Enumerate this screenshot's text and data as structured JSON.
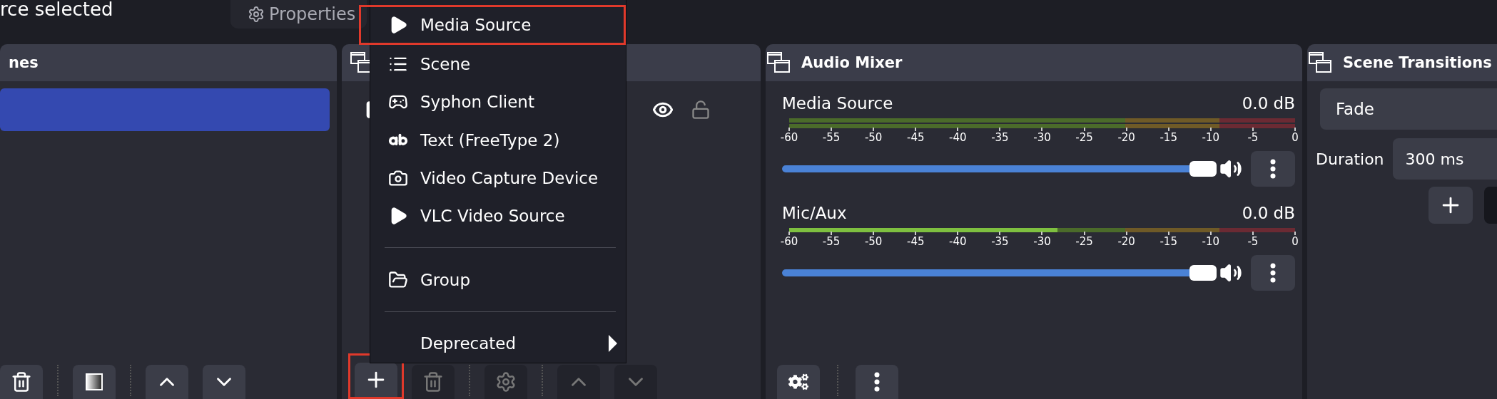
{
  "top_bar": {
    "selection_label": "rce selected",
    "tabs": [
      {
        "label": "Properties",
        "selected": false
      }
    ]
  },
  "scenes": {
    "title": "nes",
    "items": [
      {
        "selected": true
      }
    ],
    "toolbar": [
      {
        "kind": "delete",
        "disabled": false
      },
      {
        "kind": "filter",
        "disabled": false
      },
      {
        "kind": "up",
        "disabled": false
      },
      {
        "kind": "down",
        "disabled": false
      }
    ]
  },
  "sources": {
    "items": [
      {
        "visible": true,
        "locked": false
      }
    ],
    "toolbar": [
      {
        "kind": "add",
        "disabled": false,
        "annotated": true
      },
      {
        "kind": "delete",
        "disabled": true
      },
      {
        "kind": "properties",
        "disabled": true
      },
      {
        "kind": "up",
        "disabled": true
      },
      {
        "kind": "down",
        "disabled": true
      }
    ]
  },
  "add_source_menu": {
    "items": [
      {
        "kind": "media",
        "label": "Media Source",
        "annotated": true
      },
      {
        "kind": "scene",
        "label": "Scene",
        "annotated": false
      },
      {
        "kind": "syphon",
        "label": "Syphon Client",
        "annotated": false
      },
      {
        "kind": "text",
        "label": "Text (FreeType 2)",
        "annotated": false
      },
      {
        "kind": "camera",
        "label": "Video Capture Device",
        "annotated": false
      },
      {
        "kind": "vlc",
        "label": "VLC Video Source",
        "annotated": false
      },
      {
        "kind": "separator"
      },
      {
        "kind": "group",
        "label": "Group",
        "annotated": false
      },
      {
        "kind": "separator"
      },
      {
        "kind": "submenu",
        "label": "Deprecated",
        "annotated": false
      }
    ]
  },
  "audio_mixer": {
    "title": "Audio Mixer",
    "channels": [
      {
        "name": "Media Source",
        "reading": "0.0 dB",
        "meters": [
          {
            "lit": false
          },
          {
            "lit": false
          }
        ],
        "scale": [
          "-60",
          "-55",
          "-50",
          "-45",
          "-40",
          "-35",
          "-30",
          "-25",
          "-20",
          "-15",
          "-10",
          "-5",
          "0"
        ],
        "fader": {
          "level": 1
        },
        "muted": false
      },
      {
        "name": "Mic/Aux",
        "reading": "0.0 dB",
        "meters": [
          {
            "level": 0.53
          }
        ],
        "scale": [
          "-60",
          "-55",
          "-50",
          "-45",
          "-40",
          "-35",
          "-30",
          "-25",
          "-20",
          "-15",
          "-10",
          "-5",
          "0"
        ],
        "fader": {
          "level": 1
        },
        "muted": false
      }
    ],
    "toolbar": [
      {
        "kind": "advanced",
        "disabled": false
      },
      {
        "kind": "menu",
        "disabled": false
      }
    ]
  },
  "scene_transitions": {
    "title": "Scene Transitions",
    "transition": "Fade",
    "duration_label": "Duration",
    "duration": "300 ms",
    "toolbar": [
      {
        "kind": "add",
        "disabled": false
      },
      {
        "kind": "blank",
        "disabled": true
      }
    ]
  }
}
